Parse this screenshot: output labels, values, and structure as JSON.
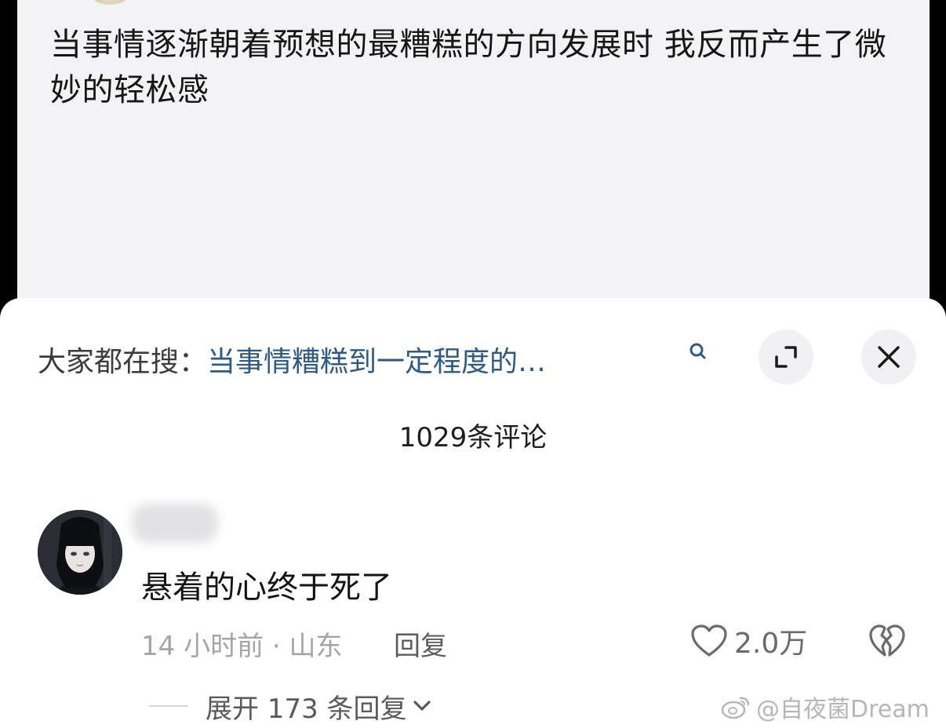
{
  "post": {
    "text": "当事情逐渐朝着预想的最糟糕的方向发展时  我反而产生了微妙的轻松感"
  },
  "search": {
    "prefix": "大家都在搜：",
    "query": "当事情糟糕到一定程度的…"
  },
  "comments": {
    "count_label": "1029条评论",
    "first": {
      "text": "悬着的心终于死了",
      "meta": "14 小时前 · 山东",
      "reply_label": "回复",
      "like_count": "2.0万",
      "expand_label": "展开 173 条回复"
    }
  },
  "watermark": {
    "text": "@自夜菌Dream"
  },
  "icons": {
    "search": "search-icon",
    "expand": "expand-icon",
    "close": "close-icon",
    "like": "heart-icon",
    "dislike": "broken-heart-icon",
    "chevron": "chevron-down-icon",
    "weibo": "weibo-logo-icon"
  },
  "colors": {
    "link": "#2d5a86",
    "muted": "#a5a5a8",
    "post_bg": "#f3f3f5"
  }
}
